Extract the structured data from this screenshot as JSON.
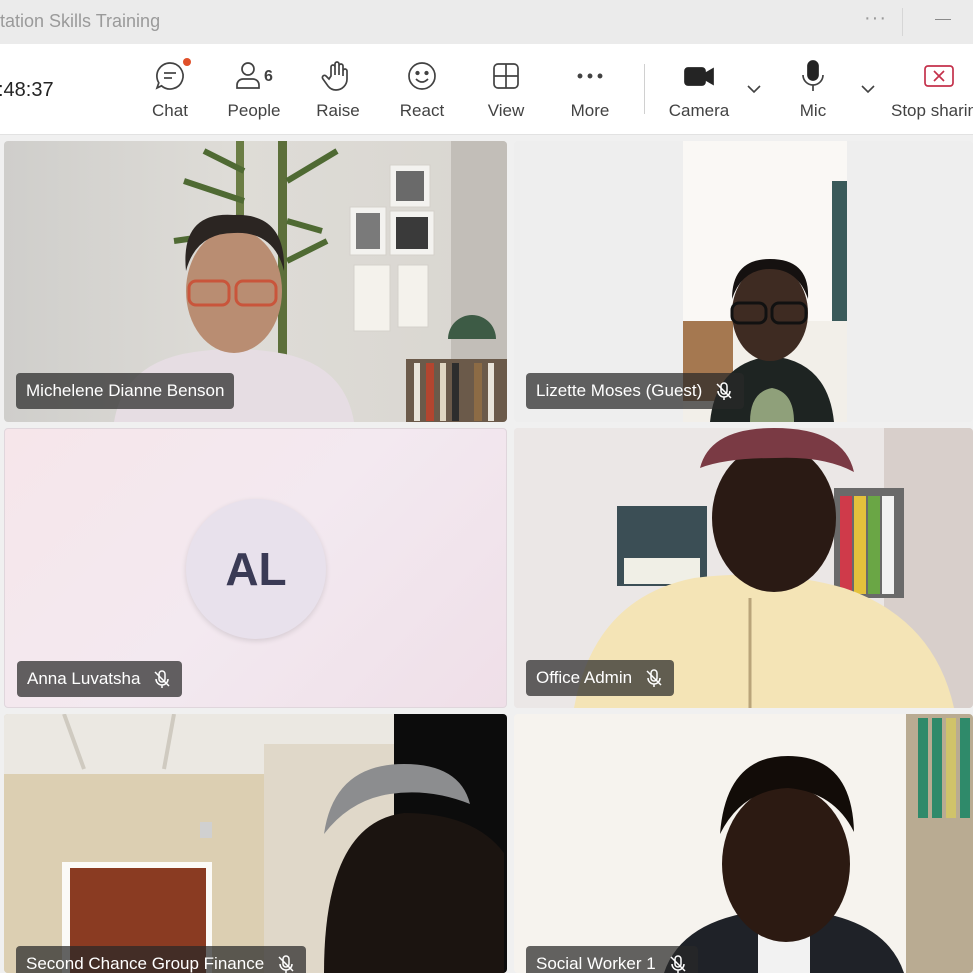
{
  "window": {
    "title": "itation Skills Training"
  },
  "toolbar": {
    "timer": ":48:37",
    "chat_label": "Chat",
    "people_label": "People",
    "people_count": "6",
    "raise_label": "Raise",
    "react_label": "React",
    "view_label": "View",
    "more_label": "More",
    "camera_label": "Camera",
    "mic_label": "Mic",
    "stop_label": "Stop sharin"
  },
  "participants": [
    {
      "name": "Michelene Dianne Benson",
      "muted": false
    },
    {
      "name": "Lizette Moses (Guest)",
      "muted": true
    },
    {
      "name": "Anna Luvatsha",
      "muted": true,
      "initials": "AL"
    },
    {
      "name": "Office Admin",
      "muted": true
    },
    {
      "name": "Second Chance Group Finance",
      "muted": true
    },
    {
      "name": "Social Worker 1",
      "muted": true
    }
  ],
  "colors": {
    "accent_red": "#c4314b",
    "notification": "#e0502a",
    "name_tag_bg": "#282828"
  }
}
